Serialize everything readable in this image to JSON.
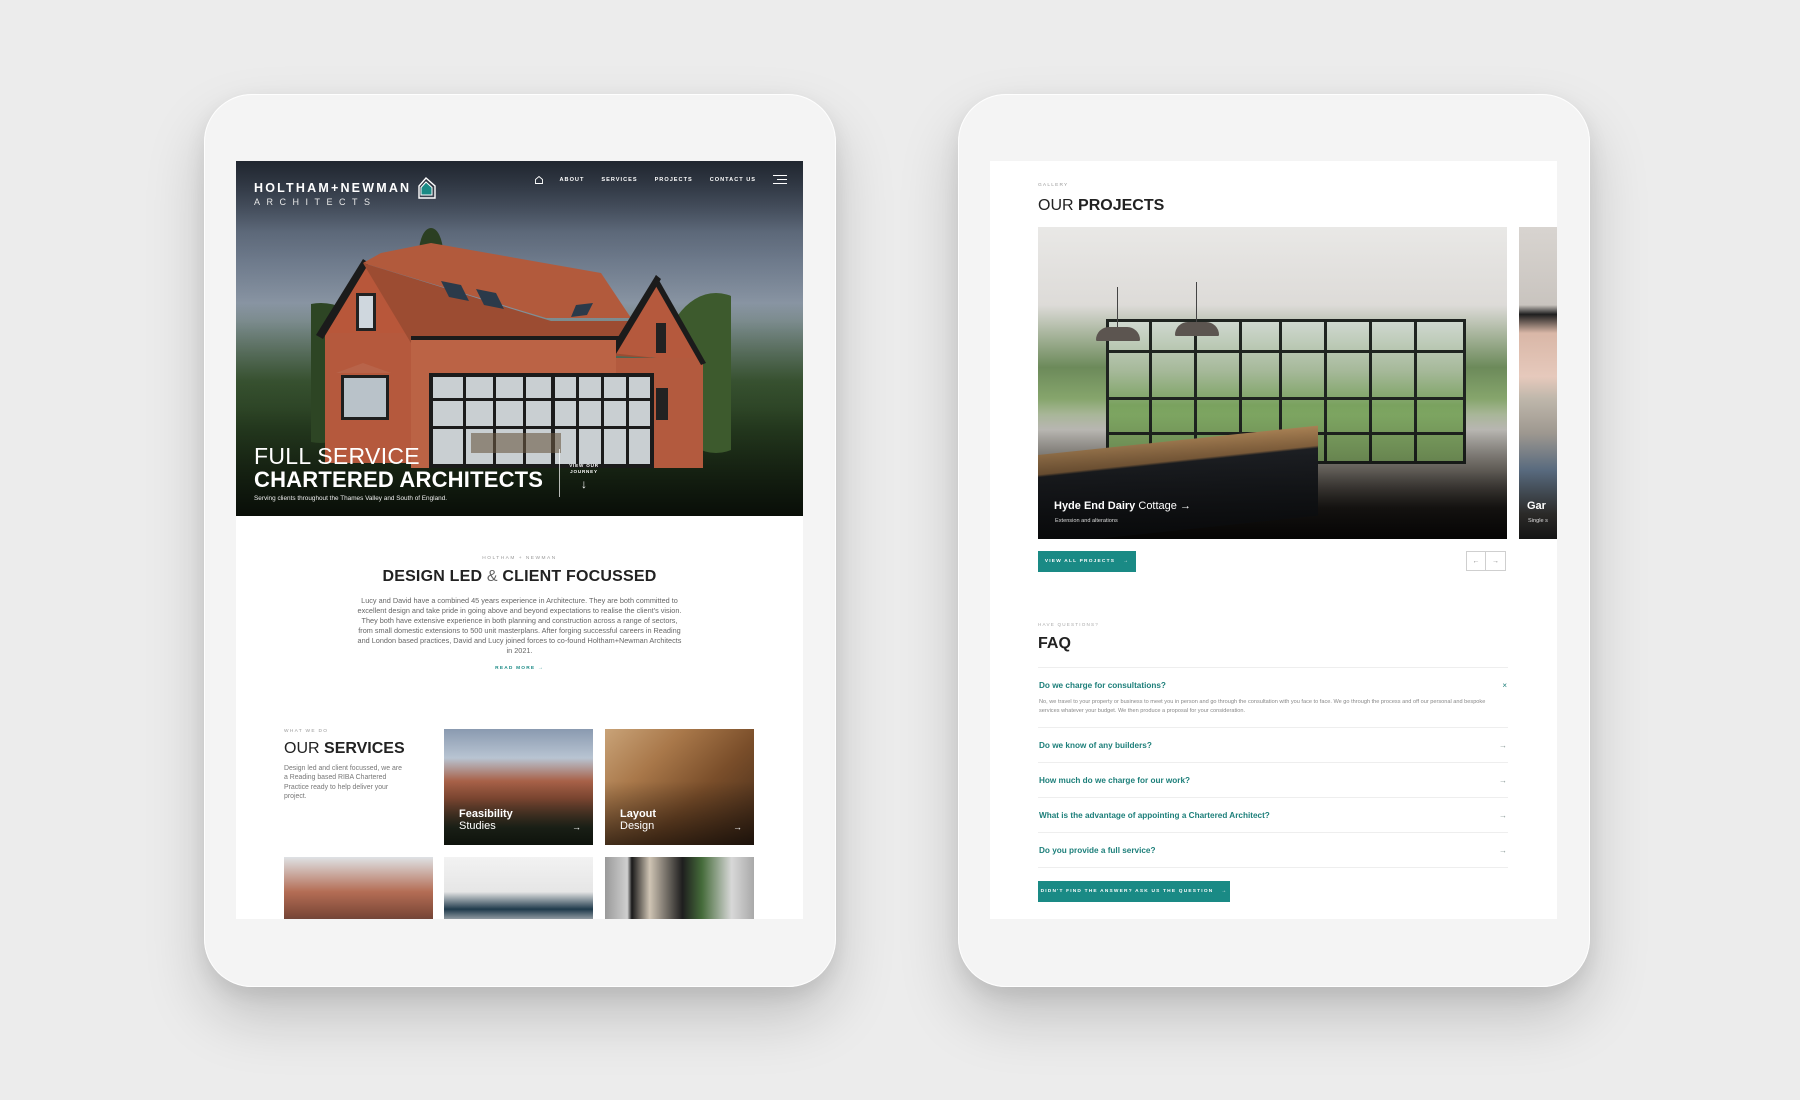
{
  "left_screen": {
    "brand": {
      "name": "HOLTHAM+NEWMAN",
      "sub": "ARCHITECTS"
    },
    "nav": {
      "home_icon": "home-icon",
      "items": [
        "ABOUT",
        "SERVICES",
        "PROJECTS",
        "CONTACT US"
      ],
      "menu_icon": "hamburger-menu-icon"
    },
    "hero": {
      "line1": "FULL SERVICE",
      "line2": "CHARTERED ARCHITECTS",
      "subtitle": "Serving clients throughout the Thames Valley and South of England.",
      "journey_label": "VIEW OUR JOURNEY",
      "journey_arrow": "↓"
    },
    "intro": {
      "eyebrow": "HOLTHAM + NEWMAN",
      "title_part1": "DESIGN LED",
      "title_amp": "&",
      "title_part2": "CLIENT FOCUSSED",
      "body": "Lucy and David have a combined 45 years experience in Architecture. They are both committed to excellent design and take pride in going above and beyond expectations to realise the client's vision. They both have extensive experience in both planning and construction across a range of sectors, from small domestic extensions to 500 unit masterplans. After forging successful careers in Reading and London based practices, David and Lucy joined forces to co-found Holtham+Newman Architects in 2021.",
      "read_more": "READ MORE →"
    },
    "services": {
      "eyebrow": "WHAT WE DO",
      "title_light": "OUR",
      "title_bold": "SERVICES",
      "body": "Design led and client focussed, we are a Reading based RIBA Chartered Practice ready to help deliver your project.",
      "tiles": [
        {
          "bold": "Feasibility",
          "light": "Studies",
          "arrow": "→"
        },
        {
          "bold": "Layout",
          "light": "Design",
          "arrow": "→"
        },
        {
          "bold": "",
          "light": "",
          "arrow": ""
        },
        {
          "bold": "",
          "light": "",
          "arrow": ""
        },
        {
          "bold": "",
          "light": "",
          "arrow": ""
        }
      ]
    }
  },
  "right_screen": {
    "gallery": {
      "eyebrow": "GALLERY",
      "title_light": "OUR",
      "title_bold": "PROJECTS",
      "projects": [
        {
          "name_bold": "Hyde End Dairy",
          "name_light": "Cottage",
          "arrow": "→",
          "subtitle": "Extension and alterations"
        },
        {
          "name_bold": "Gar",
          "subtitle": "Single s"
        }
      ],
      "view_all": "VIEW ALL PROJECTS",
      "view_all_arrow": "→",
      "prev": "←",
      "next": "→"
    },
    "faq": {
      "eyebrow": "HAVE QUESTIONS?",
      "title": "FAQ",
      "items": [
        {
          "question": "Do we charge for consultations?",
          "expanded": true,
          "icon": "×",
          "answer": "No, we travel to your property or business to meet you in person and go through the consultation with you face to face. We go through the process and off our personal and bespoke services whatever your budget. We then produce a proposal for your consideration."
        },
        {
          "question": "Do we know of any builders?",
          "expanded": false,
          "icon": "→"
        },
        {
          "question": "How much do we charge for our work?",
          "expanded": false,
          "icon": "→"
        },
        {
          "question": "What is the advantage of appointing a Chartered Architect?",
          "expanded": false,
          "icon": "→"
        },
        {
          "question": "Do you provide a full service?",
          "expanded": false,
          "icon": "→"
        }
      ],
      "ask_button": "DIDN'T FIND THE ANSWER? ASK US THE QUESTION",
      "ask_arrow": "→"
    }
  },
  "colors": {
    "accent_teal": "#1a8a85",
    "faq_text_teal": "#1d7f7a",
    "background": "#ececec",
    "bezel": "#f4f4f4"
  }
}
